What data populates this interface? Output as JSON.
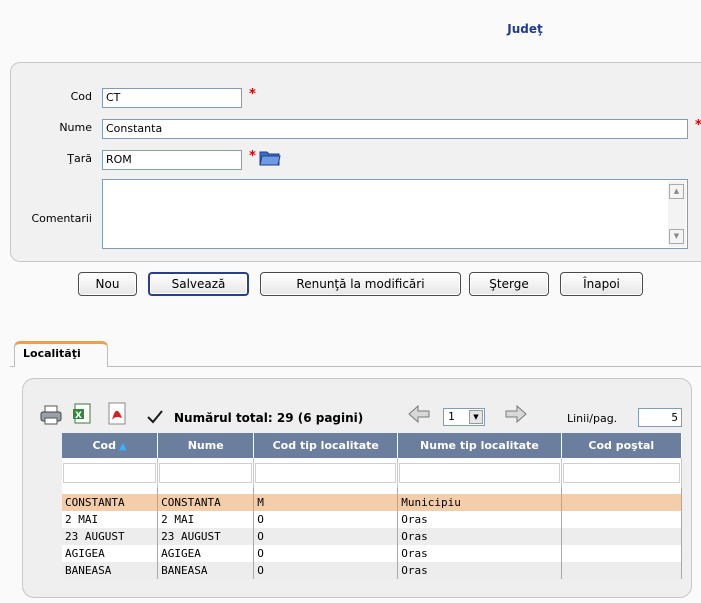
{
  "header": {
    "title": "Judeţ"
  },
  "form": {
    "cod": {
      "label": "Cod",
      "value": "CT"
    },
    "nume": {
      "label": "Nume",
      "value": "Constanta"
    },
    "tara": {
      "label": "Ţară",
      "value": "ROM"
    },
    "comentarii": {
      "label": "Comentarii",
      "value": ""
    },
    "required_mark": "*"
  },
  "buttons": {
    "nou": "Nou",
    "salveaza": "Salvează",
    "renunta": "Renunţă la modificări",
    "sterge": "Şterge",
    "inapoi": "Înapoi"
  },
  "tabs": {
    "localitati": "Localităţi"
  },
  "list": {
    "total_label": "Numărul total: 29 (6 pagini)",
    "page_value": "1",
    "lines_label": "Linii/pag.",
    "lines_value": "5",
    "columns": [
      "Cod",
      "Nume",
      "Cod tip localitate",
      "Nume tip localitate",
      "Cod poştal"
    ],
    "rows": [
      [
        "CONSTANTA",
        "CONSTANTA",
        "M",
        "Municipiu",
        ""
      ],
      [
        "2 MAI",
        "2 MAI",
        "O",
        "Oras",
        ""
      ],
      [
        "23 AUGUST",
        "23 AUGUST",
        "O",
        "Oras",
        ""
      ],
      [
        "AGIGEA",
        "AGIGEA",
        "O",
        "Oras",
        ""
      ],
      [
        "BANEASA",
        "BANEASA",
        "O",
        "Oras",
        ""
      ]
    ]
  },
  "icons": {
    "print": "printer-icon",
    "excel": "excel-icon",
    "pdf": "pdf-icon",
    "check": "checkmark-icon",
    "prev": "arrow-left-icon",
    "next": "arrow-right-icon",
    "folder": "folder-icon",
    "sort": "sort-up-icon"
  },
  "colors": {
    "header_bg": "#6b7e9e",
    "selected_row": "#f4ceab",
    "tab_accent": "#e8a24a",
    "title": "#1f3a93",
    "required": "#e00000"
  }
}
